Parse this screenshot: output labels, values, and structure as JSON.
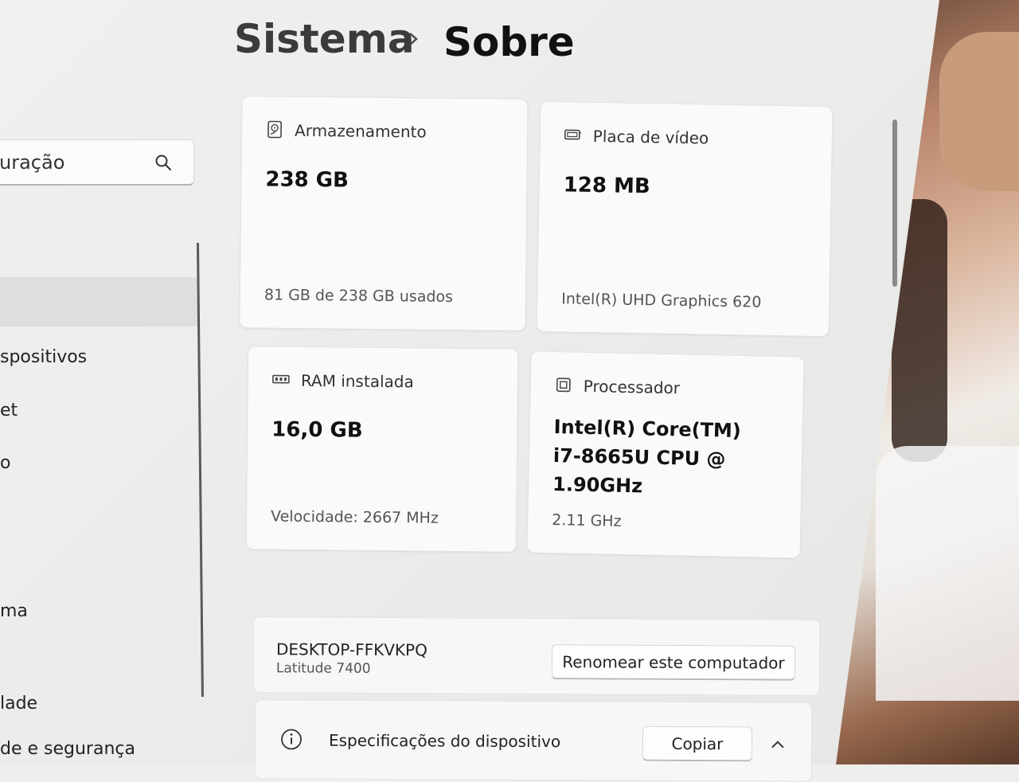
{
  "sidebar": {
    "search_value": "uração",
    "items": [
      {
        "label": "spositivos"
      },
      {
        "label": "et"
      },
      {
        "label": "o"
      },
      {
        "label": "ma"
      },
      {
        "label": "lade"
      },
      {
        "label": "de e segurança"
      }
    ]
  },
  "header": {
    "crumb_parent": "Sistema",
    "crumb_current": "Sobre"
  },
  "cards": {
    "storage": {
      "title": "Armazenamento",
      "value": "238 GB",
      "sub": "81 GB de 238 GB usados",
      "icon": "storage-drive-icon"
    },
    "gpu": {
      "title": "Placa de vídeo",
      "value": "128 MB",
      "sub": "Intel(R) UHD Graphics 620",
      "icon": "display-adapter-icon"
    },
    "ram": {
      "title": "RAM instalada",
      "value": "16,0 GB",
      "sub": "Velocidade: 2667 MHz",
      "icon": "ram-module-icon"
    },
    "cpu": {
      "title": "Processador",
      "value": "Intel(R) Core(TM) i7-8665U CPU @ 1.90GHz",
      "sub": "2.11 GHz",
      "icon": "processor-chip-icon"
    }
  },
  "device": {
    "name": "DESKTOP-FFKVKPQ",
    "model": "Latitude 7400",
    "rename_label": "Renomear este computador"
  },
  "specs": {
    "label": "Especificações do dispositivo",
    "copy_label": "Copiar"
  }
}
